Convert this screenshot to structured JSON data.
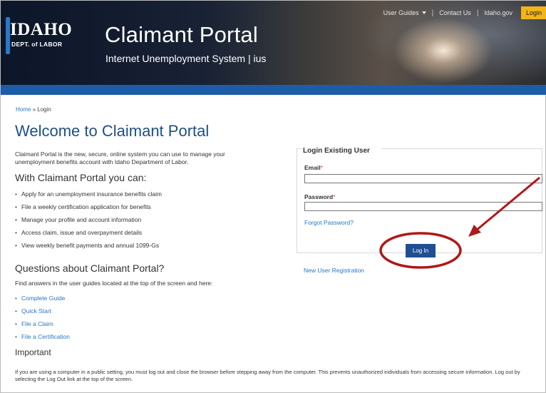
{
  "header": {
    "logo_top": "IDAHO",
    "logo_bottom": "DEPT. of LABOR",
    "title": "Claimant Portal",
    "subtitle": "Internet Unemployment System | ius"
  },
  "topnav": {
    "user_guides": "User Guides",
    "contact_us": "Contact Us",
    "idaho_gov": "Idaho.gov",
    "login": "Login"
  },
  "breadcrumb": {
    "home": "Home",
    "sep": " » ",
    "current": "Login"
  },
  "main": {
    "heading": "Welcome to Claimant Portal",
    "intro": "Claimant Portal is the new, secure, online system you can use to manage your unemployment benefits account with Idaho Department of Labor.",
    "can_heading": "With Claimant Portal you can:",
    "features": [
      "Apply for an unemployment insurance benefits claim",
      "File a weekly certification application for benefits",
      "Manage your profile and account information",
      "Access claim, issue and overpayment details",
      "View weekly benefit payments and annual 1099-Gs"
    ],
    "questions_heading": "Questions about Claimant Portal?",
    "questions_intro": "Find answers in the user guides located at the top of the screen and here:",
    "guide_links": [
      "Complete Guide",
      "Quick Start",
      "File a Claim",
      "File a Certification"
    ],
    "important_heading": "Important",
    "important_text": "If you are using a computer in a public setting, you must log out and close the browser before stepping away from the computer. This prevents unauthorized individuals from accessing secure information. Log out by selecting the Log Out link at the top of the screen."
  },
  "login_box": {
    "legend": "Login Existing User",
    "email_label": "Email",
    "password_label": "Password",
    "required_mark": "*",
    "email_value": "",
    "password_value": "",
    "forgot": "Forgot Password?",
    "button": "Log In",
    "new_user": "New User Registration"
  },
  "colors": {
    "brand_blue": "#1f5ca8",
    "heading_blue": "#1d4f8a",
    "link_blue": "#2a76c6",
    "login_yellow": "#f2b518",
    "annotation_red": "#b01818"
  },
  "icons": {
    "dropdown": "chevron-down-icon"
  }
}
